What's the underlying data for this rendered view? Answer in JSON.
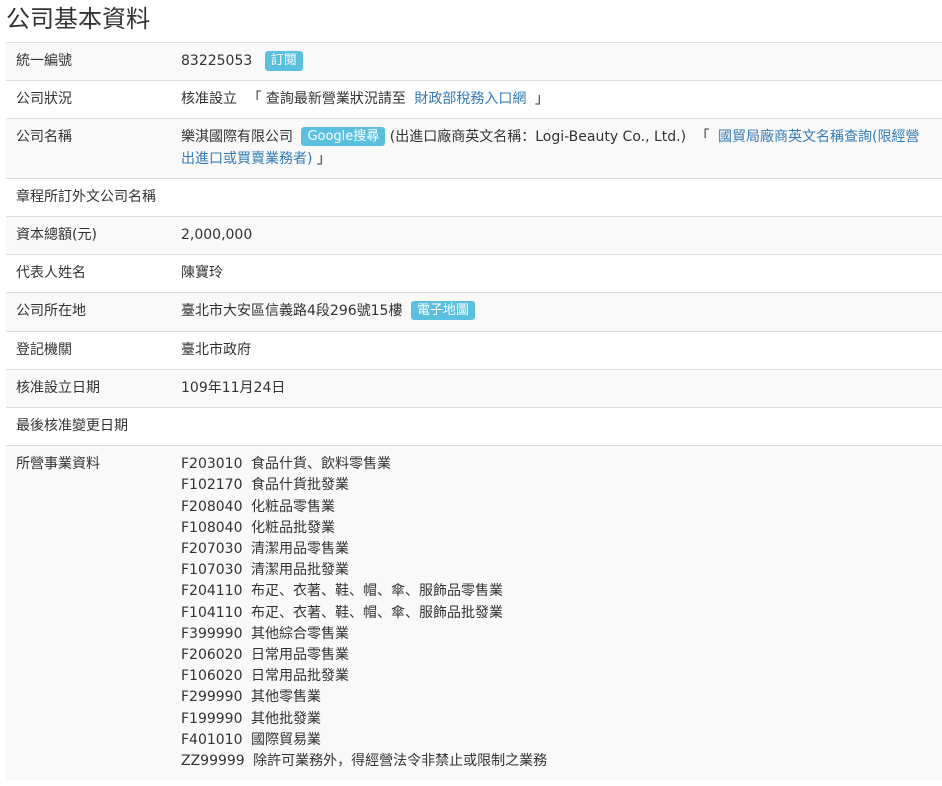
{
  "page": {
    "title": "公司基本資料"
  },
  "colors": {
    "text": "#333333",
    "link": "#337ab7",
    "badge_bg": "#5bc0de",
    "badge_text": "#ffffff",
    "stripe": "#f9f9f9",
    "border": "#dddddd",
    "background": "#ffffff"
  },
  "rows": {
    "tax_id": {
      "label": "統一編號",
      "value": "83225053",
      "subscribe_label": "訂閱"
    },
    "status": {
      "label": "公司狀況",
      "value": "核准設立",
      "open_bracket": "「",
      "note": "查詢最新營業狀況請至",
      "link_text": "財政部稅務入口網",
      "close_bracket": "」"
    },
    "name": {
      "label": "公司名稱",
      "value": "樂淇國際有限公司",
      "google_search_label": "Google搜尋",
      "english_name_text": "(出進口廠商英文名稱：Logi-Beauty Co., Ltd.)",
      "open_bracket": "「",
      "link_text": "國貿局廠商英文名稱查詢(限經營出進口或買賣業務者)",
      "close_bracket": "」"
    },
    "foreign_name": {
      "label": "章程所訂外文公司名稱"
    },
    "capital": {
      "label": "資本總額(元)",
      "value": "2,000,000"
    },
    "representative": {
      "label": "代表人姓名",
      "value": "陳寶玲"
    },
    "address": {
      "label": "公司所在地",
      "value": "臺北市大安區信義路4段296號15樓",
      "map_label": "電子地圖"
    },
    "registration_authority": {
      "label": "登記機關",
      "value": "臺北市政府"
    },
    "approval_date": {
      "label": "核准設立日期",
      "value": "109年11月24日"
    },
    "last_change_date": {
      "label": "最後核准變更日期"
    },
    "business": {
      "label": "所營事業資料",
      "items": [
        {
          "code": "F203010",
          "desc": "食品什貨、飲料零售業"
        },
        {
          "code": "F102170",
          "desc": "食品什貨批發業"
        },
        {
          "code": "F208040",
          "desc": "化粧品零售業"
        },
        {
          "code": "F108040",
          "desc": "化粧品批發業"
        },
        {
          "code": "F207030",
          "desc": "清潔用品零售業"
        },
        {
          "code": "F107030",
          "desc": "清潔用品批發業"
        },
        {
          "code": "F204110",
          "desc": "布疋、衣著、鞋、帽、傘、服飾品零售業"
        },
        {
          "code": "F104110",
          "desc": "布疋、衣著、鞋、帽、傘、服飾品批發業"
        },
        {
          "code": "F399990",
          "desc": "其他綜合零售業"
        },
        {
          "code": "F206020",
          "desc": "日常用品零售業"
        },
        {
          "code": "F106020",
          "desc": "日常用品批發業"
        },
        {
          "code": "F299990",
          "desc": "其他零售業"
        },
        {
          "code": "F199990",
          "desc": "其他批發業"
        },
        {
          "code": "F401010",
          "desc": "國際貿易業"
        },
        {
          "code": "ZZ99999",
          "desc": "除許可業務外，得經營法令非禁止或限制之業務"
        }
      ]
    }
  }
}
